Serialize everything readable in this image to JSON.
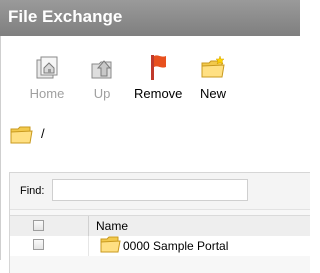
{
  "window": {
    "title": "File Exchange"
  },
  "toolbar": {
    "home_label": "Home",
    "up_label": "Up",
    "remove_label": "Remove",
    "new_label": "New"
  },
  "path": {
    "current": "/"
  },
  "grid": {
    "find_label": "Find:",
    "find_value": "",
    "columns": {
      "name": "Name"
    },
    "rows": [
      {
        "name": "0000 Sample Portal"
      }
    ]
  },
  "colors": {
    "titlebar": "#8c8c8c",
    "folder": "#f2c94c",
    "remove_flag": "#e8501e",
    "disabled_text": "#a0a0a0"
  },
  "icons": {
    "home": "home-icon",
    "up": "up-icon",
    "remove": "remove-flag-icon",
    "new": "new-folder-icon",
    "path": "folder-icon"
  }
}
